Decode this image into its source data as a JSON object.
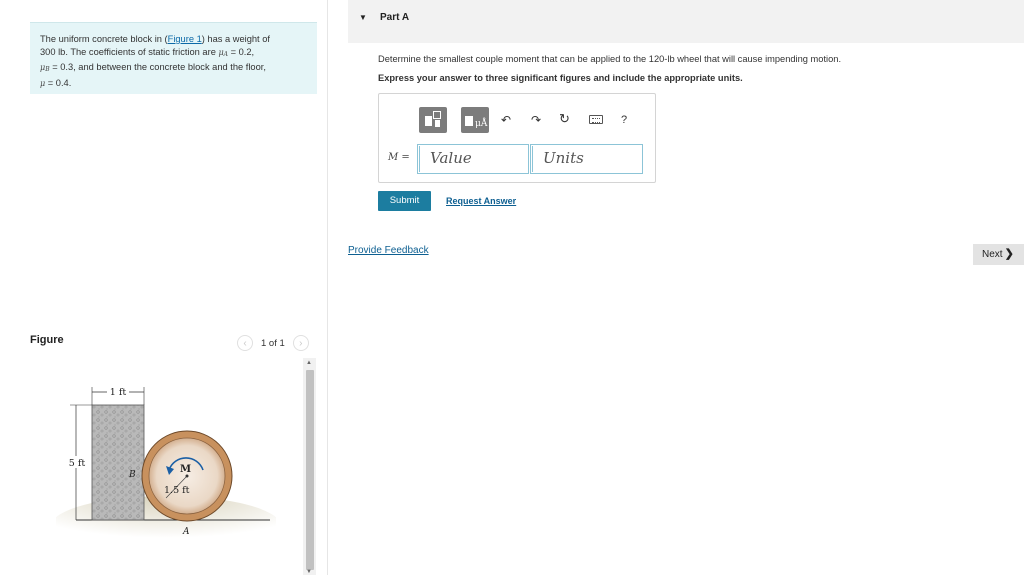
{
  "problem": {
    "text_1": "The uniform concrete block in (",
    "figure_link": "Figure 1",
    "text_2": ") has a weight of",
    "text_3": "300 lb. The coefficients of static friction are",
    "mu_a": "μA",
    "text_4": " = 0.2,",
    "mu_b": "μB",
    "text_5": " = 0.3, and between the concrete block and the floor,",
    "mu": "μ",
    "text_6": " = 0.4."
  },
  "figure": {
    "title": "Figure",
    "counter": "1 of 1",
    "prev_icon": "chevron-left-icon",
    "next_icon": "chevron-right-icon",
    "labels": {
      "width": "1 ft",
      "height": "5 ft",
      "point_b": "B",
      "moment": "M",
      "radius": "1.5 ft",
      "point_a": "A"
    }
  },
  "part": {
    "caret_icon": "caret-down-icon",
    "title": "Part A",
    "question": "Determine the smallest couple moment that can be applied to the 120-lb wheel that will cause impending motion.",
    "instruction": "Express your answer to three significant figures and include the appropriate units."
  },
  "answer": {
    "label_var": "M",
    "label_eq": " =",
    "value_placeholder": "Value",
    "units_placeholder": "Units",
    "toolbar": {
      "templates_icon": "templates-icon",
      "units_icon": "units-icon",
      "units_text": "μÅ",
      "undo_icon": "undo-icon",
      "redo_icon": "redo-icon",
      "reset_icon": "reset-icon",
      "keyboard_icon": "keyboard-icon",
      "help": "?"
    }
  },
  "actions": {
    "submit": "Submit",
    "request_answer": "Request Answer",
    "provide_feedback": "Provide Feedback",
    "next": "Next",
    "next_icon": "chevron-right-icon"
  },
  "colors": {
    "problem_bg": "#e5f5f7",
    "submit_bg": "#1c7da0",
    "link": "#0d5f91",
    "field_border": "#8cc4d7"
  }
}
